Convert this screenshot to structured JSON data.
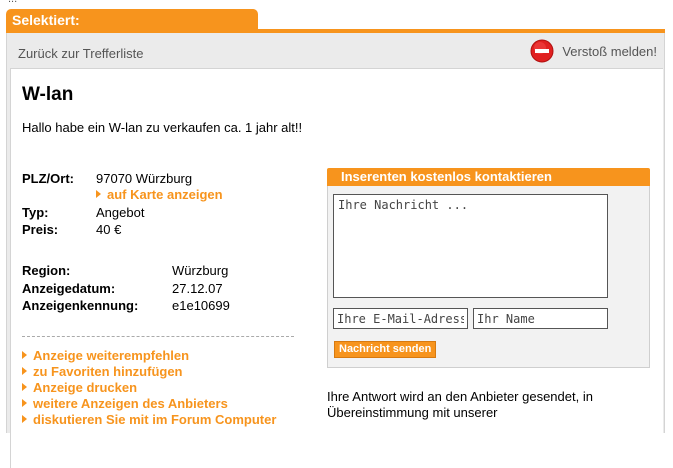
{
  "top_clipped_text": "...",
  "tab": {
    "label": "Selektiert:"
  },
  "header": {
    "back_link": "Zurück zur Trefferliste",
    "report_label": "Verstoß melden!"
  },
  "listing": {
    "title": "W-lan",
    "description": "Hallo habe ein W-lan zu verkaufen ca. 1 jahr alt!!",
    "plz_label": "PLZ/Ort:",
    "plz_value": "97070 Würzburg",
    "map_link": "auf Karte anzeigen",
    "type_label": "Typ:",
    "type_value": "Angebot",
    "price_label": "Preis:",
    "price_value": "40 €",
    "region_label": "Region:",
    "region_value": "Würzburg",
    "date_label": "Anzeigedatum:",
    "date_value": "27.12.07",
    "id_label": "Anzeigenkennung:",
    "id_value": "e1e10699"
  },
  "actions": [
    "Anzeige weiterempfehlen",
    "zu Favoriten hinzufügen",
    "Anzeige drucken",
    "weitere Anzeigen des Anbieters",
    "diskutieren Sie mit im Forum Computer"
  ],
  "contact": {
    "heading": "Inserenten kostenlos kontaktieren",
    "message_placeholder": "Ihre Nachricht ...",
    "email_placeholder": "Ihre E-Mail-Adresse",
    "name_placeholder": "Ihr Name",
    "send_label": "Nachricht senden",
    "info_text": "Ihre Antwort wird an den Anbieter gesendet, in Übereinstimmung mit unserer"
  },
  "colors": {
    "accent": "#f7941d",
    "panel_bg": "#ebebeb",
    "report_red": "#e02020"
  },
  "icons": {
    "report": "no-entry-icon",
    "link_arrow": "triangle-right-icon"
  }
}
